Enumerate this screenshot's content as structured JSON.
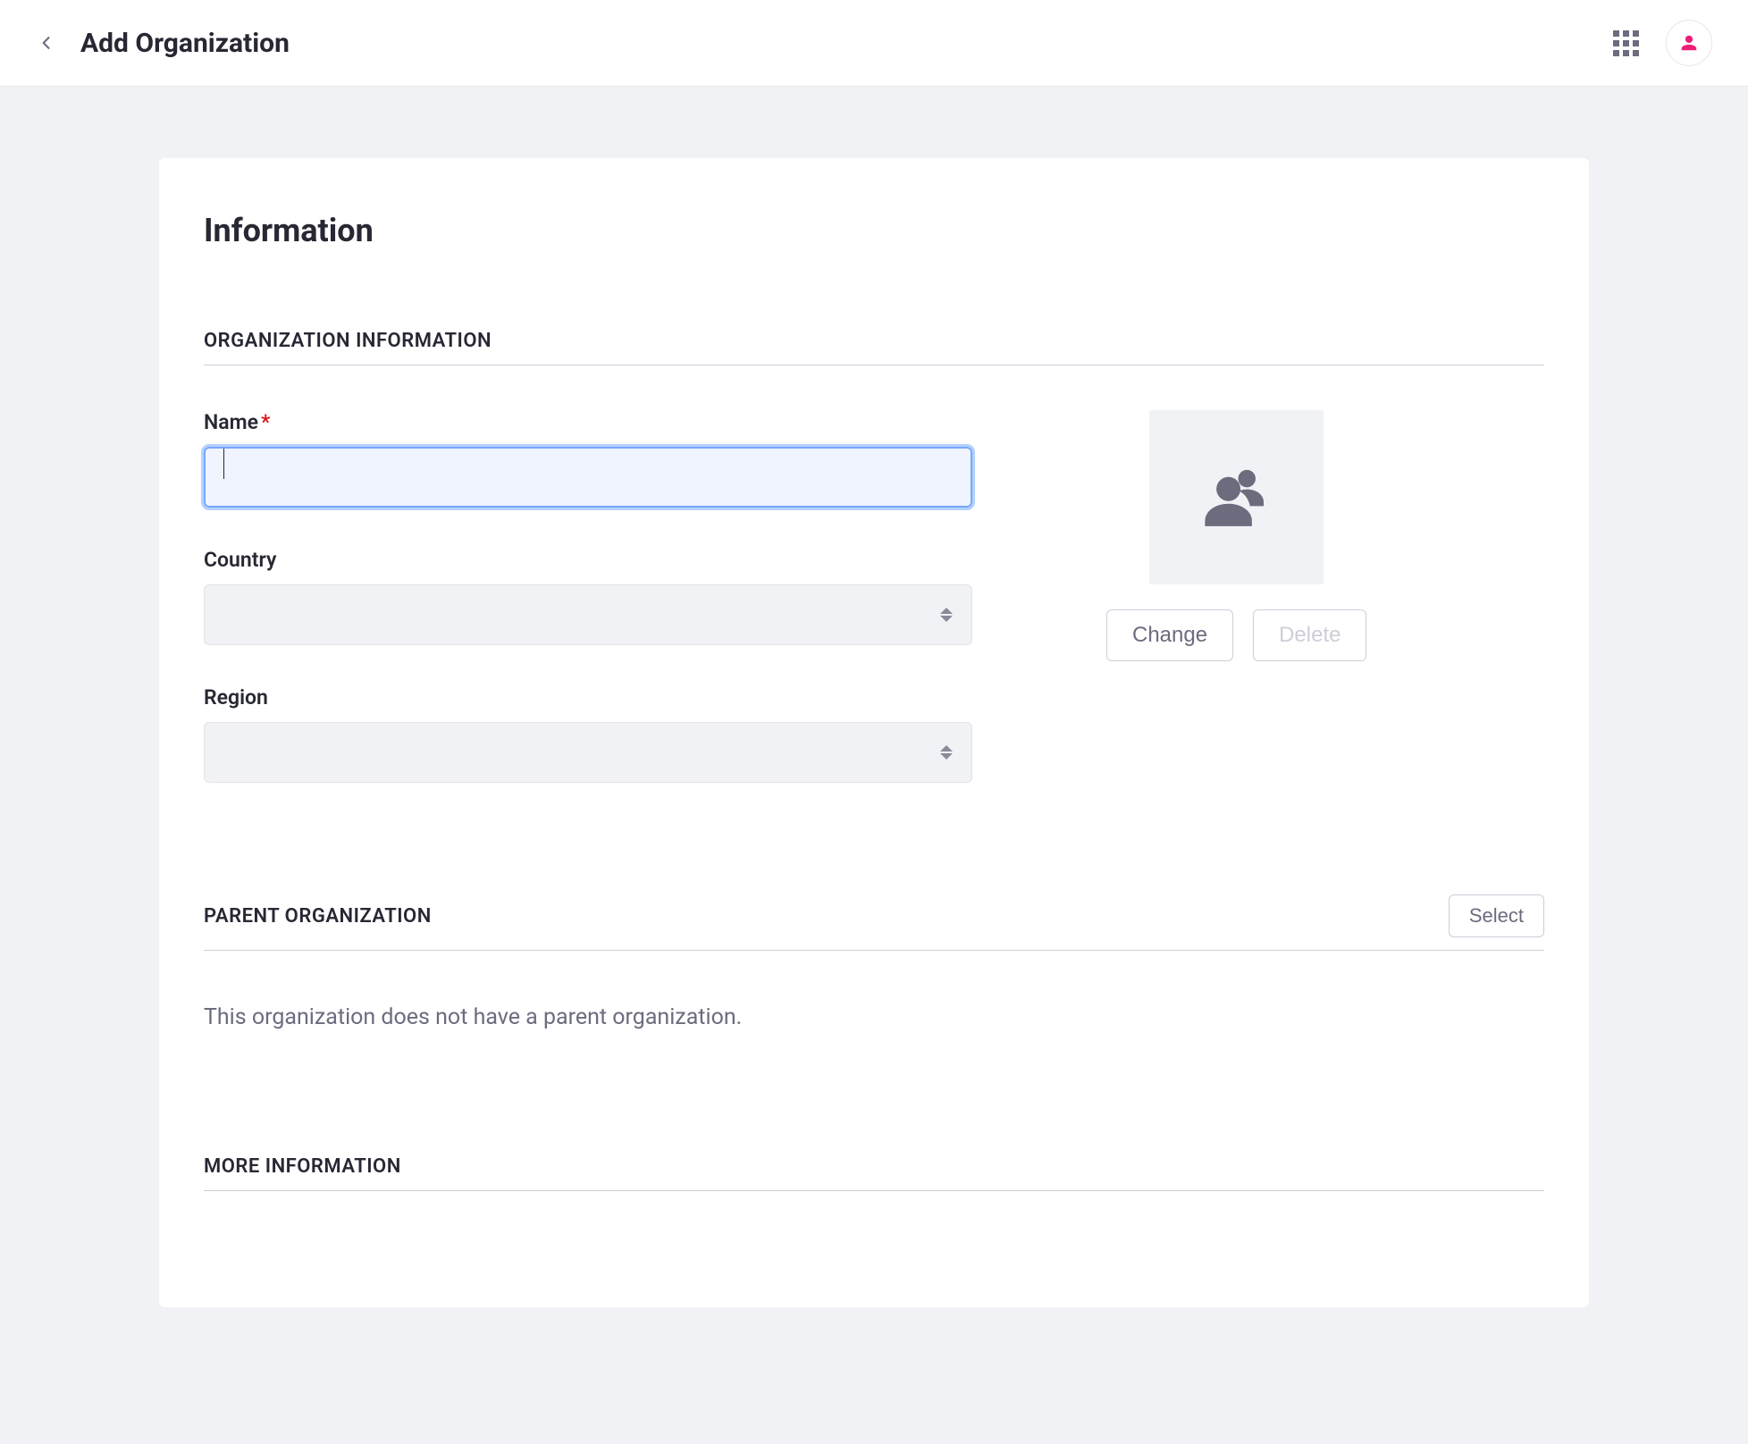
{
  "header": {
    "title": "Add Organization"
  },
  "card": {
    "title": "Information"
  },
  "sections": {
    "org_info": "ORGANIZATION INFORMATION",
    "parent_org": "PARENT ORGANIZATION",
    "more_info": "MORE INFORMATION"
  },
  "fields": {
    "name_label": "Name",
    "name_value": "",
    "country_label": "Country",
    "country_value": "",
    "region_label": "Region",
    "region_value": ""
  },
  "logo": {
    "change_label": "Change",
    "delete_label": "Delete"
  },
  "parent": {
    "select_label": "Select",
    "empty_text": "This organization does not have a parent organization."
  }
}
